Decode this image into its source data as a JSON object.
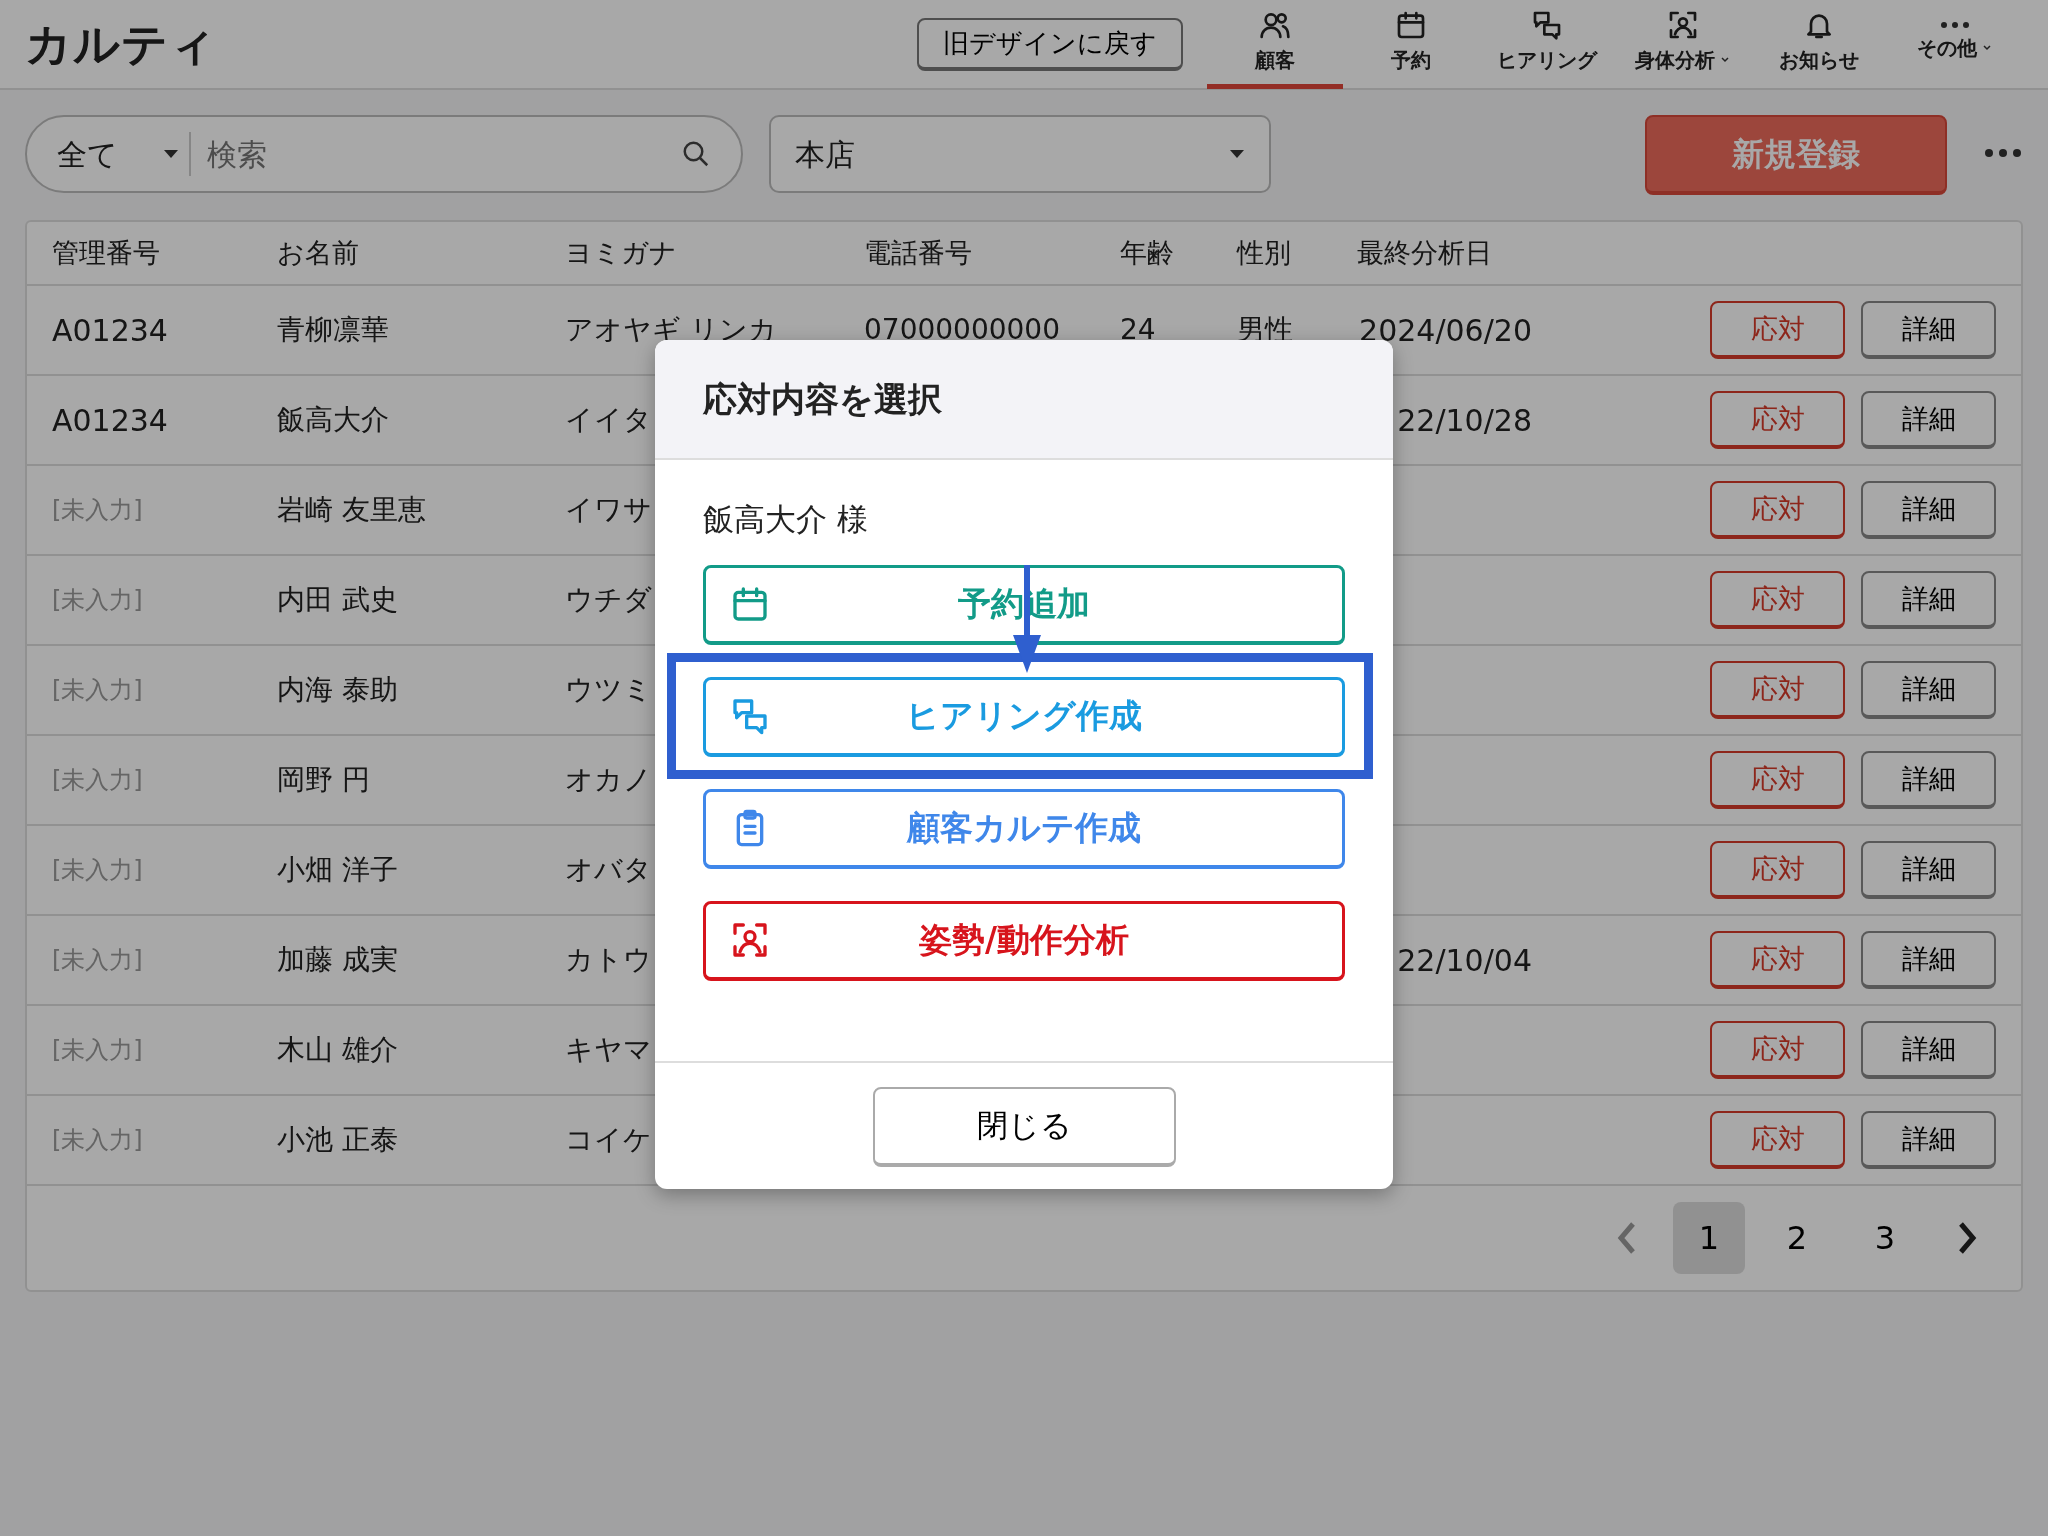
{
  "header": {
    "logo": "カルティ",
    "legacy_button": "旧デザインに戻す",
    "nav": [
      {
        "label": "顧客",
        "selected": true,
        "dropdown": false
      },
      {
        "label": "予約",
        "selected": false,
        "dropdown": false
      },
      {
        "label": "ヒアリング",
        "selected": false,
        "dropdown": false
      },
      {
        "label": "身体分析",
        "selected": false,
        "dropdown": true
      },
      {
        "label": "お知らせ",
        "selected": false,
        "dropdown": false
      },
      {
        "label": "その他",
        "selected": false,
        "dropdown": true
      }
    ]
  },
  "toolbar": {
    "filter": "全て",
    "search": {
      "placeholder": "検索"
    },
    "store": "本店",
    "new_button": "新規登録"
  },
  "table": {
    "columns": [
      "管理番号",
      "お名前",
      "ヨミガナ",
      "電話番号",
      "年齢",
      "性別",
      "最終分析日"
    ],
    "rows": [
      {
        "id": "A01234",
        "id_missing": false,
        "name": "青柳凛華",
        "yomi": "アオヤギ リンカ",
        "phone": "07000000000",
        "age": "24",
        "gender": "男性",
        "date": "2024/06/20",
        "actions": [
          "応対",
          "詳細"
        ]
      },
      {
        "id": "A01234",
        "id_missing": false,
        "name": "飯高大介",
        "yomi": "イイタ",
        "date": "22/10/28",
        "actions": [
          "応対",
          "詳細"
        ]
      },
      {
        "id": "[未入力]",
        "id_missing": true,
        "name": "岩崎 友里恵",
        "yomi": "イワサ",
        "actions": [
          "応対",
          "詳細"
        ]
      },
      {
        "id": "[未入力]",
        "id_missing": true,
        "name": "内田 武史",
        "yomi": "ウチダ",
        "actions": [
          "応対",
          "詳細"
        ]
      },
      {
        "id": "[未入力]",
        "id_missing": true,
        "name": "内海 泰助",
        "yomi": "ウツミ",
        "actions": [
          "応対",
          "詳細"
        ]
      },
      {
        "id": "[未入力]",
        "id_missing": true,
        "name": "岡野 円",
        "yomi": "オカノ",
        "actions": [
          "応対",
          "詳細"
        ]
      },
      {
        "id": "[未入力]",
        "id_missing": true,
        "name": "小畑 洋子",
        "yomi": "オバタ",
        "actions": [
          "応対",
          "詳細"
        ]
      },
      {
        "id": "[未入力]",
        "id_missing": true,
        "name": "加藤 成実",
        "yomi": "カトウ",
        "date": "22/10/04",
        "actions": [
          "応対",
          "詳細"
        ]
      },
      {
        "id": "[未入力]",
        "id_missing": true,
        "name": "木山 雄介",
        "yomi": "キヤマ",
        "actions": [
          "応対",
          "詳細"
        ]
      },
      {
        "id": "[未入力]",
        "id_missing": true,
        "name": "小池 正泰",
        "yomi": "コイケ",
        "actions": [
          "応対",
          "詳細"
        ]
      }
    ]
  },
  "pagination": {
    "prev_disabled": true,
    "pages": [
      {
        "label": "1",
        "selected": true
      },
      {
        "label": "2",
        "selected": false
      },
      {
        "label": "3",
        "selected": false
      }
    ]
  },
  "modal": {
    "title": "応対内容を選択",
    "customer": "飯高大介 様",
    "actions": [
      {
        "label": "予約追加",
        "color": "#129b88",
        "highlighted": false
      },
      {
        "label": "ヒアリング作成",
        "color": "#1a9be0",
        "highlighted": true
      },
      {
        "label": "顧客カルテ作成",
        "color": "#3f87ea",
        "highlighted": false
      },
      {
        "label": "姿勢/動作分析",
        "color": "#d7141c",
        "highlighted": false
      }
    ],
    "close": "閉じる"
  }
}
